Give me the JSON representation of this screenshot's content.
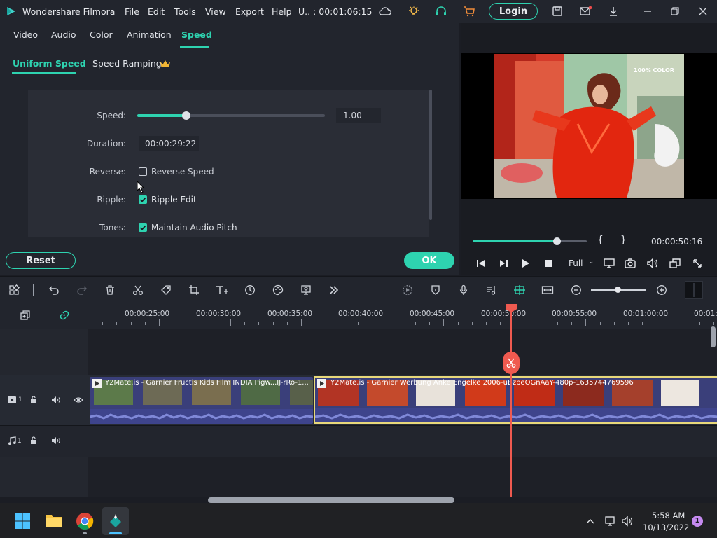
{
  "titlebar": {
    "app_name": "Wondershare Filmora",
    "menus": [
      "File",
      "Edit",
      "Tools",
      "View",
      "Export",
      "Help"
    ],
    "project_info": "U.. : 00:01:06:15",
    "login_label": "Login"
  },
  "tabs": [
    "Video",
    "Audio",
    "Color",
    "Animation",
    "Speed"
  ],
  "active_tab": "Speed",
  "subtabs": {
    "uniform": "Uniform Speed",
    "ramping": "Speed Ramping"
  },
  "speed": {
    "label": "Speed:",
    "value": "1.00",
    "slider_level": 0.26
  },
  "duration": {
    "label": "Duration:",
    "value": "00:00:29:22"
  },
  "reverse": {
    "label": "Reverse:",
    "option": "Reverse Speed",
    "checked": false
  },
  "ripple": {
    "label": "Ripple:",
    "option": "Ripple Edit",
    "checked": true
  },
  "tones": {
    "label": "Tones:",
    "option": "Maintain Audio Pitch",
    "checked": true
  },
  "buttons": {
    "reset": "Reset",
    "ok": "OK"
  },
  "preview": {
    "overlay_text": "100% COLOR",
    "timecode": "00:00:50:16",
    "progress_level": 0.6,
    "bracket_in": "{",
    "bracket_out": "}",
    "quality": "Full"
  },
  "ruler": {
    "ticks": [
      "00:00:25:00",
      "00:00:30:00",
      "00:00:35:00",
      "00:00:40:00",
      "00:00:45:00",
      "00:00:50:00",
      "00:00:55:00",
      "00:01:00:00",
      "00:01:0"
    ]
  },
  "tracks": {
    "video_track_num": "1",
    "audio_track_num": "1",
    "clip1_title": "Y2Mate.is - Garnier Fructis Kids Film INDIA Pigw...IJ-rRo-1...",
    "clip2_title": "Y2Mate.is - Garnier Werbung Anke Engelke 2006-uBzbeOGnAaY-480p-1635744769596"
  },
  "taskbar": {
    "time": "5:58 AM",
    "date": "10/13/2022",
    "notification_count": "1"
  },
  "colors": {
    "accent": "#2ed3b0",
    "playhead": "#ef5a50",
    "clip_border": "#e8d87a",
    "panel": "#22252d"
  }
}
